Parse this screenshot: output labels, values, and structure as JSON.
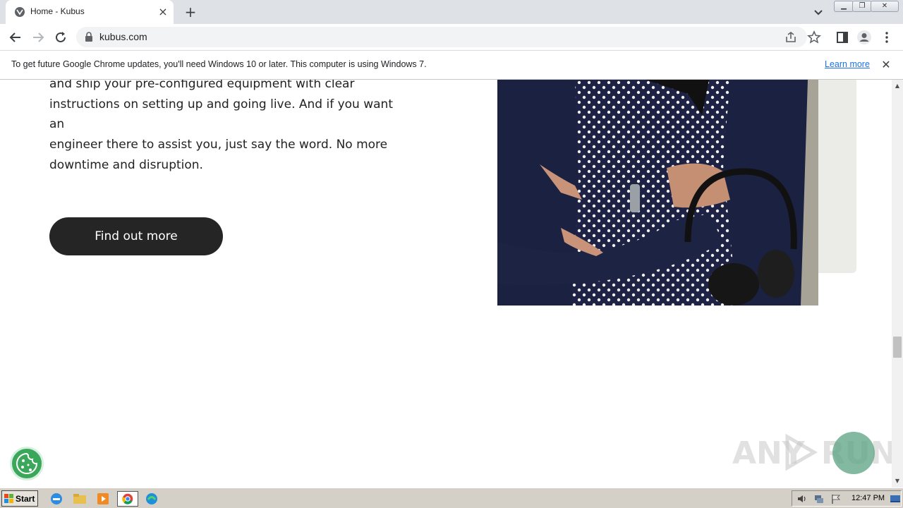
{
  "browser": {
    "tab_title": "Home - Kubus",
    "url": "kubus.com"
  },
  "infobar": {
    "message": "To get future Google Chrome updates, you'll need Windows 10 or later. This computer is using Windows 7.",
    "link": "Learn more"
  },
  "page": {
    "paragraph_lines": [
      "and ship your pre-configured equipment with clear",
      "instructions on setting up and going live. And if you want an",
      "engineer there to assist you, just say the word. No more",
      "downtime and disruption."
    ],
    "cta_label": "Find out more"
  },
  "watermark": {
    "text_left": "ANY",
    "text_right": "RUN"
  },
  "taskbar": {
    "start_label": "Start",
    "clock": "12:47 PM"
  },
  "colors": {
    "button_bg": "#252525",
    "cookie_green": "#3aa75a",
    "link_blue": "#1a73e8"
  }
}
